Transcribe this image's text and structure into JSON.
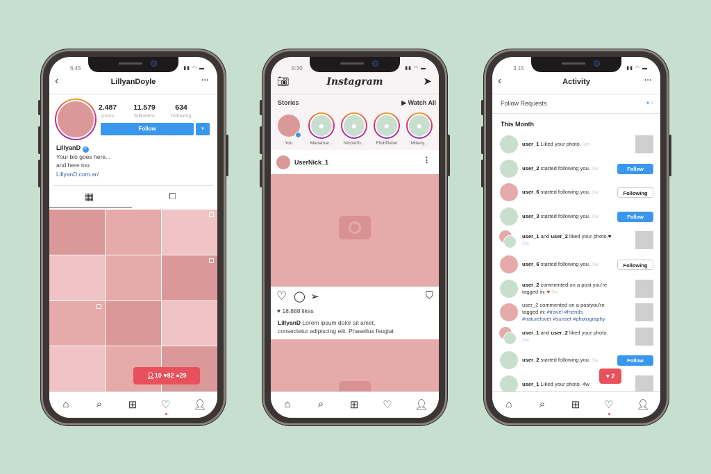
{
  "colors": {
    "background": "#c6dfcf",
    "accent_blue": "#3a97ee",
    "badge_red": "#e8505b",
    "pink": "#e5aaa9",
    "green_avatar": "#c8dfcf"
  },
  "profile_phone": {
    "status_time": "6:45",
    "title": "LillyanDoyle",
    "stats": [
      {
        "value": "2.487",
        "label": "posts"
      },
      {
        "value": "11.579",
        "label": "followers"
      },
      {
        "value": "634",
        "label": "following"
      }
    ],
    "follow_label": "Follow",
    "name": "LillyanD",
    "bio_lines": [
      "Your bio goes here...",
      "and here too."
    ],
    "link": "LillyanD.com.ar/",
    "grid_colors": [
      "#db9899",
      "#e5aaa9",
      "#f0c4c4",
      "#f0c4c4",
      "#e5aaa9",
      "#db9899",
      "#e5aaa9",
      "#db9899",
      "#f0c4c4",
      "#f0c4c4",
      "#e5aaa9",
      "#db9899"
    ],
    "notification": {
      "followers": "10",
      "likes": "82",
      "comments": "29"
    }
  },
  "feed_phone": {
    "status_time": "9:30",
    "logo": "Instagram",
    "stories_label": "Stories",
    "watch_all": "▶ Watch All",
    "stories": [
      {
        "name": "You"
      },
      {
        "name": "Mariamar..."
      },
      {
        "name": "NicolaTo..."
      },
      {
        "name": "Flishflisher"
      },
      {
        "name": "Minery..."
      }
    ],
    "post_user": "UserNick_1",
    "likes": "18,888 likes",
    "caption_user": "LillyanD",
    "caption_line1": " Lorem ipsum dolor sit amet,",
    "caption_line2": "consectetur adipiscing elit. Phasellus feugiat"
  },
  "activity_phone": {
    "status_time": "3:15",
    "title": "Activity",
    "follow_requests": "Follow Requests",
    "follow_requests_count": "2",
    "section": "This Month",
    "rows": [
      {
        "avatar": "green",
        "parts": [
          {
            "b": "user_1"
          },
          {
            "t": " Liked your photo. "
          },
          {
            "tm": "1m"
          }
        ],
        "right": "thumb"
      },
      {
        "avatar": "green",
        "parts": [
          {
            "b": "user_2"
          },
          {
            "t": " started following you. "
          },
          {
            "tm": "3w"
          }
        ],
        "right": "Follow"
      },
      {
        "avatar": "pink",
        "parts": [
          {
            "b": "user_6"
          },
          {
            "t": " started following you. "
          },
          {
            "tm": "1w"
          }
        ],
        "right": "Following"
      },
      {
        "avatar": "green",
        "parts": [
          {
            "b": "user_3"
          },
          {
            "t": " started following you. "
          },
          {
            "tm": "2w"
          }
        ],
        "right": "Follow"
      },
      {
        "avatar": "double",
        "parts": [
          {
            "b": "user_1"
          },
          {
            "t": " and "
          },
          {
            "b": "user_2"
          },
          {
            "t": " liked your photo."
          },
          {
            "h": "♥"
          },
          {
            "tm": " 2w"
          }
        ],
        "right": "thumb"
      },
      {
        "avatar": "pink",
        "parts": [
          {
            "b": "user_6"
          },
          {
            "t": " started following you. "
          },
          {
            "tm": "1w"
          }
        ],
        "right": "Following"
      },
      {
        "avatar": "green",
        "parts": [
          {
            "b": "user_2"
          },
          {
            "t": " commented on a post you're tagged in: "
          },
          {
            "hr": "♥"
          },
          {
            "tm": " 3w"
          }
        ],
        "right": "thumb"
      },
      {
        "avatar": "pink",
        "parts": [
          {
            "t": "user_2 commented on a postyou're tagged in: "
          },
          {
            "g": "#travel #friends #naturelover #sunset #photography"
          }
        ],
        "right": "thumb"
      },
      {
        "avatar": "double",
        "parts": [
          {
            "b": "user_1"
          },
          {
            "t": " and "
          },
          {
            "b": "user_2"
          },
          {
            "t": " liked your photo. "
          },
          {
            "tm": "2w"
          }
        ],
        "right": "thumb"
      },
      {
        "avatar": "green",
        "parts": [
          {
            "b": "user_2"
          },
          {
            "t": " started following you. "
          },
          {
            "tm": "3w"
          }
        ],
        "right": "Follow"
      },
      {
        "avatar": "green",
        "parts": [
          {
            "b": "user_1"
          },
          {
            "t": " Liked your photo. "
          },
          {
            "t": "4w"
          }
        ],
        "right": "thumb"
      }
    ],
    "notification": {
      "likes": "2"
    }
  }
}
